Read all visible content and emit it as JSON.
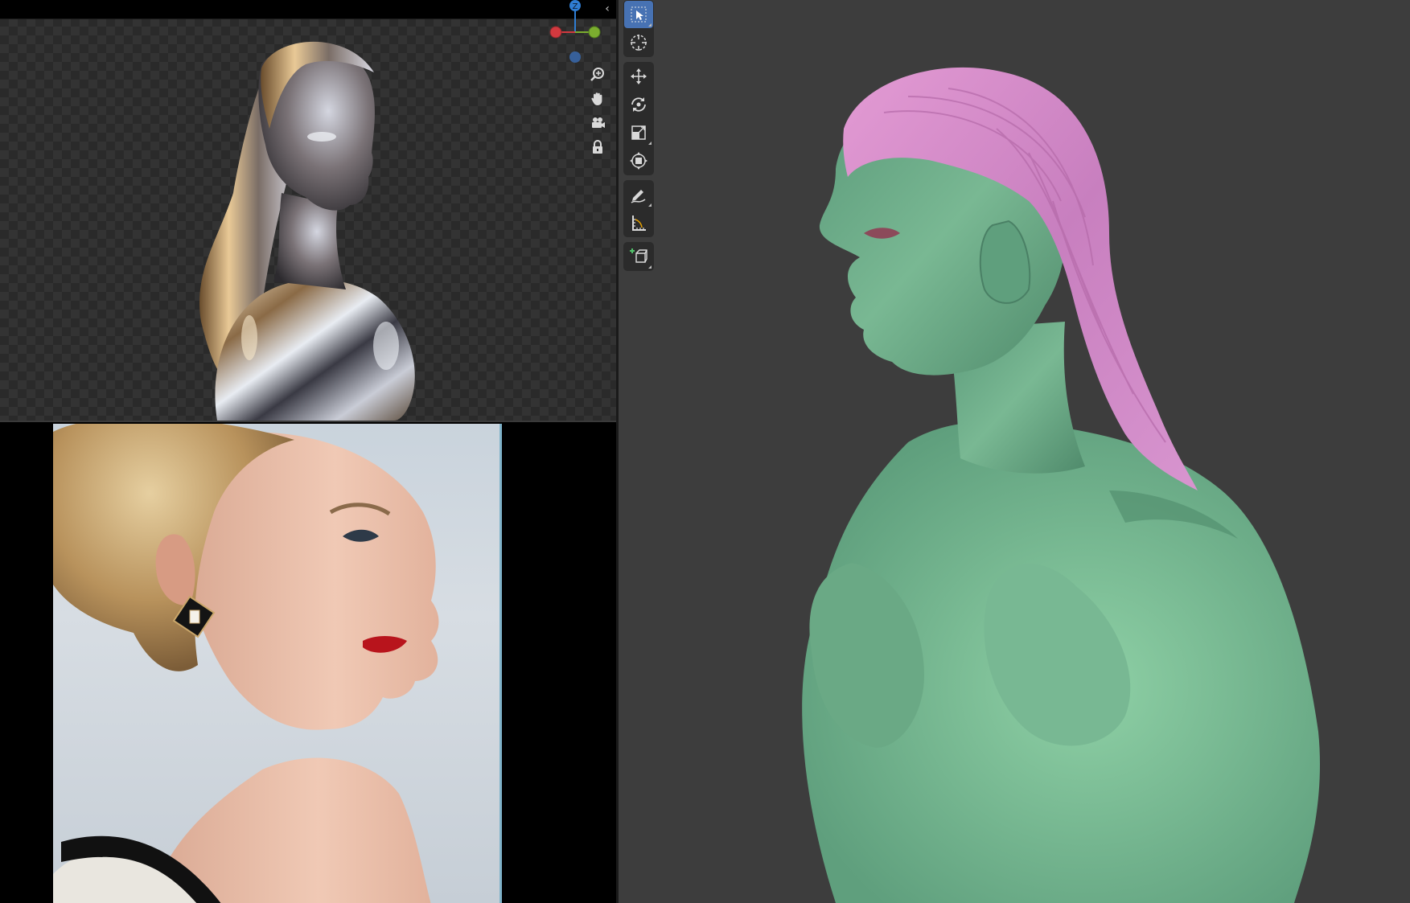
{
  "render_viewport": {
    "collapse_glyph": "‹",
    "gizmo": {
      "z_label": "Z",
      "z_color": "#2f7dd3",
      "x_color": "#d2393f",
      "y_color": "#7bad2f",
      "neg_z_color": "#37609a"
    },
    "nav_tools": [
      {
        "name": "zoom-icon"
      },
      {
        "name": "pan-hand-icon"
      },
      {
        "name": "camera-view-icon"
      },
      {
        "name": "lock-icon"
      }
    ]
  },
  "reference_panel": {
    "subject": "photo"
  },
  "sculpt_viewport": {
    "background": "#3d3d3d",
    "skin_color": "#6fae8a",
    "hair_color": "#d48bc8",
    "toolbar": {
      "groups": [
        [
          {
            "name": "select-box-icon",
            "active": true
          },
          {
            "name": "cursor-icon",
            "active": false
          }
        ],
        [
          {
            "name": "move-icon",
            "active": false
          },
          {
            "name": "rotate-icon",
            "active": false
          },
          {
            "name": "scale-icon",
            "active": false
          },
          {
            "name": "transform-icon",
            "active": false
          }
        ],
        [
          {
            "name": "annotate-icon",
            "active": false
          },
          {
            "name": "measure-icon",
            "active": false
          }
        ],
        [
          {
            "name": "add-cube-icon",
            "active": false
          }
        ]
      ],
      "active_color": "#4772b3"
    }
  }
}
